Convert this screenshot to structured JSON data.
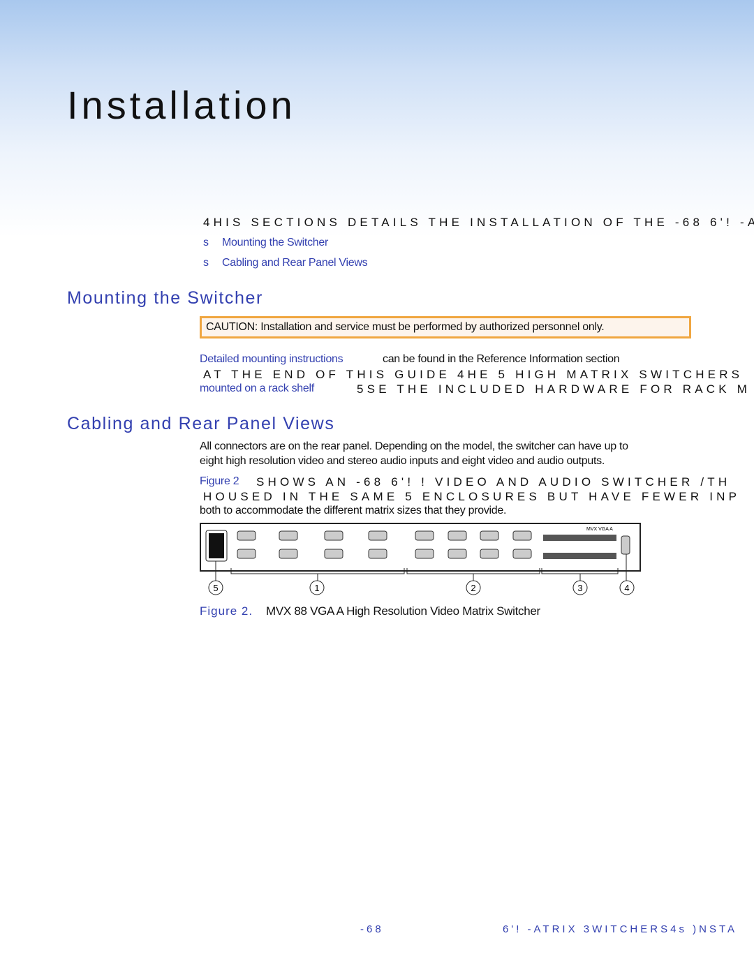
{
  "page_title": "Installation",
  "intro": {
    "text": "4HIS SECTIONS DETAILS THE INSTALLATION OF THE -68 6'! -A",
    "bullets": [
      {
        "marker": "s",
        "label": "Mounting the Switcher"
      },
      {
        "marker": "s",
        "label": "Cabling and Rear Panel Views"
      }
    ]
  },
  "mounting": {
    "heading": "Mounting the Switcher",
    "caution": "CAUTION:  Installation and service must be performed by authorized personnel only.",
    "line1_link": "Detailed mounting instructions",
    "line1_text": "can be found in the   Reference Information   section",
    "line2": "AT THE END OF THIS GUIDE  4HE  5 HIGH MATRIX SWITCHERS",
    "line3_link": "mounted on a rack shelf",
    "line3_text": "5SE THE INCLUDED HARDWARE FOR RACK M"
  },
  "cabling": {
    "heading": "Cabling and Rear Panel Views",
    "para1_line1": "All connectors are on the rear panel. Depending on the model, the switcher can have up to",
    "para1_line2": "eight high resolution video and stereo audio inputs and eight video and audio outputs.",
    "para2_link": "Figure 2",
    "para2_line1": "SHOWS AN -68    6'! ! VIDEO AND AUDIO SWITCHER  /TH",
    "para2_line2": "HOUSED IN THE SAME  5 ENCLOSURES  BUT HAVE FEWER INP",
    "para2_line3": "both to accommodate the different matrix sizes that they provide."
  },
  "figure": {
    "panel_label": "MVX VGA A",
    "callouts": [
      "5",
      "1",
      "2",
      "3",
      "4"
    ],
    "caption_label": "Figure 2.",
    "caption_text": "MVX 88 VGA A High Resolution Video Matrix Switcher"
  },
  "footer": {
    "left": "-68",
    "right": "6'! -ATRIX 3WITCHERS4s )NSTA"
  },
  "colors": {
    "link": "#3340b0",
    "caution_border": "#f0a640",
    "caution_bg": "#fdf4ec"
  }
}
